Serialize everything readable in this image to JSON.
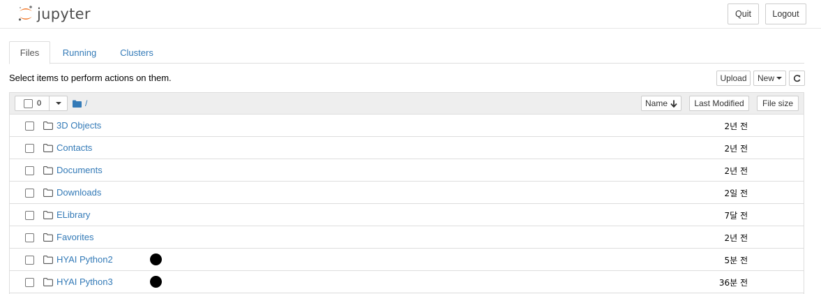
{
  "app": {
    "logo_text": "jupyter"
  },
  "header": {
    "quit_label": "Quit",
    "logout_label": "Logout"
  },
  "tabs": [
    {
      "label": "Files",
      "active": true
    },
    {
      "label": "Running",
      "active": false
    },
    {
      "label": "Clusters",
      "active": false
    }
  ],
  "toolbar": {
    "hint": "Select items to perform actions on them.",
    "upload_label": "Upload",
    "new_label": "New"
  },
  "list_header": {
    "selected_count": "0",
    "breadcrumb": "/",
    "sort_name_label": "Name",
    "sort_modified_label": "Last Modified",
    "sort_size_label": "File size"
  },
  "files": [
    {
      "name": "3D Objects",
      "modified": "2년 전"
    },
    {
      "name": "Contacts",
      "modified": "2년 전"
    },
    {
      "name": "Documents",
      "modified": "2년 전"
    },
    {
      "name": "Downloads",
      "modified": "2일 전"
    },
    {
      "name": "ELibrary",
      "modified": "7달 전"
    },
    {
      "name": "Favorites",
      "modified": "2년 전"
    },
    {
      "name": "HYAI Python2",
      "modified": "5분 전",
      "marker": true
    },
    {
      "name": "HYAI Python3",
      "modified": "36분 전",
      "marker": true
    }
  ],
  "colors": {
    "link": "#337ab7",
    "logo_orange": "#f37726"
  }
}
